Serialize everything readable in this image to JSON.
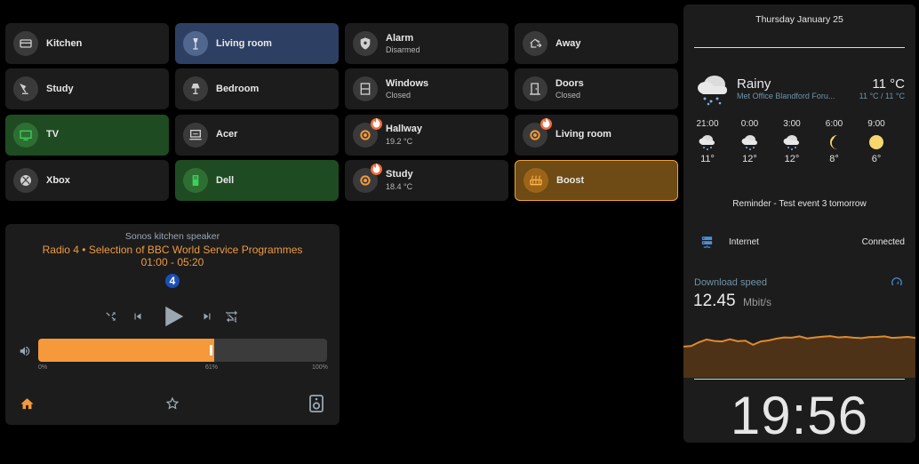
{
  "tiles": [
    {
      "name": "Kitchen",
      "state": "",
      "icon": "kitchen-icon"
    },
    {
      "name": "Living room",
      "state": "",
      "icon": "floor-lamp-icon"
    },
    {
      "name": "Alarm",
      "state": "Disarmed",
      "icon": "shield-icon"
    },
    {
      "name": "Away",
      "state": "",
      "icon": "home-export-icon"
    },
    {
      "name": "Study",
      "state": "",
      "icon": "desk-lamp-icon"
    },
    {
      "name": "Bedroom",
      "state": "",
      "icon": "lamp-icon"
    },
    {
      "name": "Windows",
      "state": "Closed",
      "icon": "window-icon"
    },
    {
      "name": "Doors",
      "state": "Closed",
      "icon": "door-icon"
    },
    {
      "name": "TV",
      "state": "",
      "icon": "tv-icon"
    },
    {
      "name": "Acer",
      "state": "",
      "icon": "computer-icon"
    },
    {
      "name": "Hallway",
      "state": "19.2 °C",
      "icon": "thermostat-icon"
    },
    {
      "name": "Living room",
      "state": "",
      "icon": "thermostat-icon"
    },
    {
      "name": "Xbox",
      "state": "",
      "icon": "xbox-icon"
    },
    {
      "name": "Dell",
      "state": "",
      "icon": "desktop-tower-icon"
    },
    {
      "name": "Study",
      "state": "18.4 °C",
      "icon": "thermostat-icon"
    },
    {
      "name": "Boost",
      "state": "",
      "icon": "radiator-icon"
    }
  ],
  "colors": {
    "accent": "#f5993b",
    "active_blue": "#2d4063",
    "active_green": "#1f4b22",
    "boost": "#6e4a14",
    "card": "#1c1c1c"
  },
  "media": {
    "source": "Sonos kitchen speaker",
    "title": "Radio 4 • Selection of BBC World Service Programmes 01:00 - 05:20",
    "channel_logo": "4",
    "volume_percent": 61,
    "volume_min_label": "0%",
    "volume_value_label": "61%",
    "volume_max_label": "100%"
  },
  "sidebar": {
    "date": "Thursday January 25",
    "weather": {
      "condition": "Rainy",
      "location": "Met Office Blandford Foru...",
      "temp": "11 °C",
      "range": "11 °C / 11 °C",
      "forecast": [
        {
          "time": "21:00",
          "temp": "11°",
          "icon": "rain-icon"
        },
        {
          "time": "0:00",
          "temp": "12°",
          "icon": "rain-icon"
        },
        {
          "time": "3:00",
          "temp": "12°",
          "icon": "rain-icon"
        },
        {
          "time": "6:00",
          "temp": "8°",
          "icon": "moon-icon"
        },
        {
          "time": "9:00",
          "temp": "6°",
          "icon": "sun-icon"
        }
      ]
    },
    "reminder": "Reminder - Test event 3 tomorrow",
    "internet": {
      "label": "Internet",
      "status": "Connected"
    },
    "download": {
      "label": "Download speed",
      "value": "12.45",
      "unit": "Mbit/s",
      "history": [
        8.8,
        9.0,
        10.5,
        11.6,
        11.0,
        10.8,
        11.7,
        10.9,
        11.1,
        9.5,
        10.8,
        11.2,
        11.9,
        12.4,
        12.3,
        12.8,
        12.0,
        12.4,
        12.7,
        12.9,
        12.4,
        12.6,
        12.3,
        12.1,
        12.5,
        12.6,
        12.8,
        12.2,
        12.4,
        12.6,
        12.2
      ]
    },
    "clock": "19:56"
  }
}
